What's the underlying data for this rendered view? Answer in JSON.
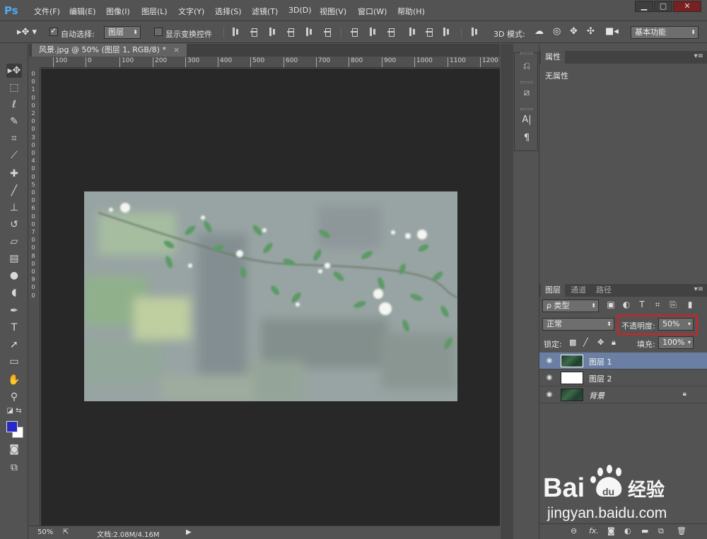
{
  "app": {
    "logo": "Ps"
  },
  "menu": [
    "文件(F)",
    "编辑(E)",
    "图像(I)",
    "图层(L)",
    "文字(Y)",
    "选择(S)",
    "滤镜(T)",
    "3D(D)",
    "视图(V)",
    "窗口(W)",
    "帮助(H)"
  ],
  "window_controls": {
    "minimize": "▁",
    "restore": "▢",
    "close": "✕"
  },
  "options": {
    "auto_select_label": "自动选择:",
    "auto_select_checked": true,
    "auto_select_target": "图层",
    "show_transform_label": "显示变换控件",
    "show_transform_checked": false,
    "mode_3d_label": "3D 模式:",
    "workspace": "基本功能"
  },
  "document": {
    "tab_title": "风景.jpg @ 50% (图层 1, RGB/8) *",
    "close": "×",
    "zoom": "50%",
    "doc_info": "文档:2.08M/4.16M"
  },
  "ruler": {
    "top_ticks": [
      "100",
      "0",
      "100",
      "200",
      "300",
      "400",
      "500",
      "600",
      "700",
      "800",
      "900",
      "1000",
      "1100",
      "1200"
    ],
    "left_ticks": [
      "0",
      "0",
      "1",
      "0",
      "0",
      "2",
      "0",
      "0",
      "3",
      "0",
      "0",
      "4",
      "0",
      "0",
      "5",
      "0",
      "0",
      "6",
      "0",
      "0",
      "7",
      "0",
      "0",
      "8",
      "0",
      "0",
      "9",
      "0",
      "0"
    ]
  },
  "tools": [
    "move-tool",
    "marquee-tool",
    "lasso-tool",
    "quick-select-tool",
    "crop-tool",
    "eyedropper-tool",
    "healing-tool",
    "brush-tool",
    "clone-stamp-tool",
    "history-brush-tool",
    "eraser-tool",
    "gradient-tool",
    "blur-tool",
    "dodge-tool",
    "pen-tool",
    "type-tool",
    "path-select-tool",
    "shape-tool",
    "hand-tool",
    "zoom-tool"
  ],
  "colors": {
    "foreground": "#2828c6",
    "background": "#ffffff",
    "selection": "#6b7fa4",
    "highlight": "#e31b1b"
  },
  "properties_panel": {
    "tab": "属性",
    "content": "无属性"
  },
  "layers_panel": {
    "tabs": [
      "图层",
      "通道",
      "路径"
    ],
    "filter_kind": "ρ 类型",
    "blend_mode": "正常",
    "opacity_label": "不透明度:",
    "opacity_value": "50%",
    "lock_label": "锁定:",
    "fill_label": "填充:",
    "fill_value": "100%",
    "layers": [
      {
        "name": "图层 1",
        "selected": true,
        "thumb": "image",
        "locked": false
      },
      {
        "name": "图层 2",
        "selected": false,
        "thumb": "white",
        "locked": false
      },
      {
        "name": "背景",
        "selected": false,
        "thumb": "image",
        "locked": true
      }
    ],
    "footer_fx": "fx."
  },
  "watermark": {
    "brand": "Bai",
    "brand_suffix": "du",
    "cn": "经验",
    "url": "jingyan.baidu.com"
  }
}
